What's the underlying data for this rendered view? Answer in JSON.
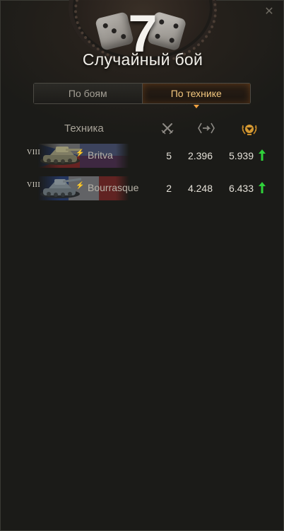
{
  "window": {
    "battle_count": "7",
    "title": "Случайный бой",
    "close_icon": "close-icon"
  },
  "tabs": [
    {
      "label": "По боям",
      "active": false
    },
    {
      "label": "По технике",
      "active": true
    }
  ],
  "table": {
    "column_vehicle_label": "Техника",
    "column_icons": [
      "crossed-swords-icon",
      "damage-icon",
      "rating-medal-icon"
    ],
    "rows": [
      {
        "tier": "VIII",
        "name": "Britva",
        "flag": "czech",
        "battles": "5",
        "damage": "2.396",
        "rating": "5.939",
        "trend": "up"
      },
      {
        "tier": "VIII",
        "name": "Bourrasque",
        "flag": "france",
        "battles": "2",
        "damage": "4.248",
        "rating": "6.433",
        "trend": "up"
      }
    ]
  },
  "colors": {
    "accent": "#f3c77e",
    "trend_up": "#2fd23a",
    "background": "#1b1b18"
  }
}
